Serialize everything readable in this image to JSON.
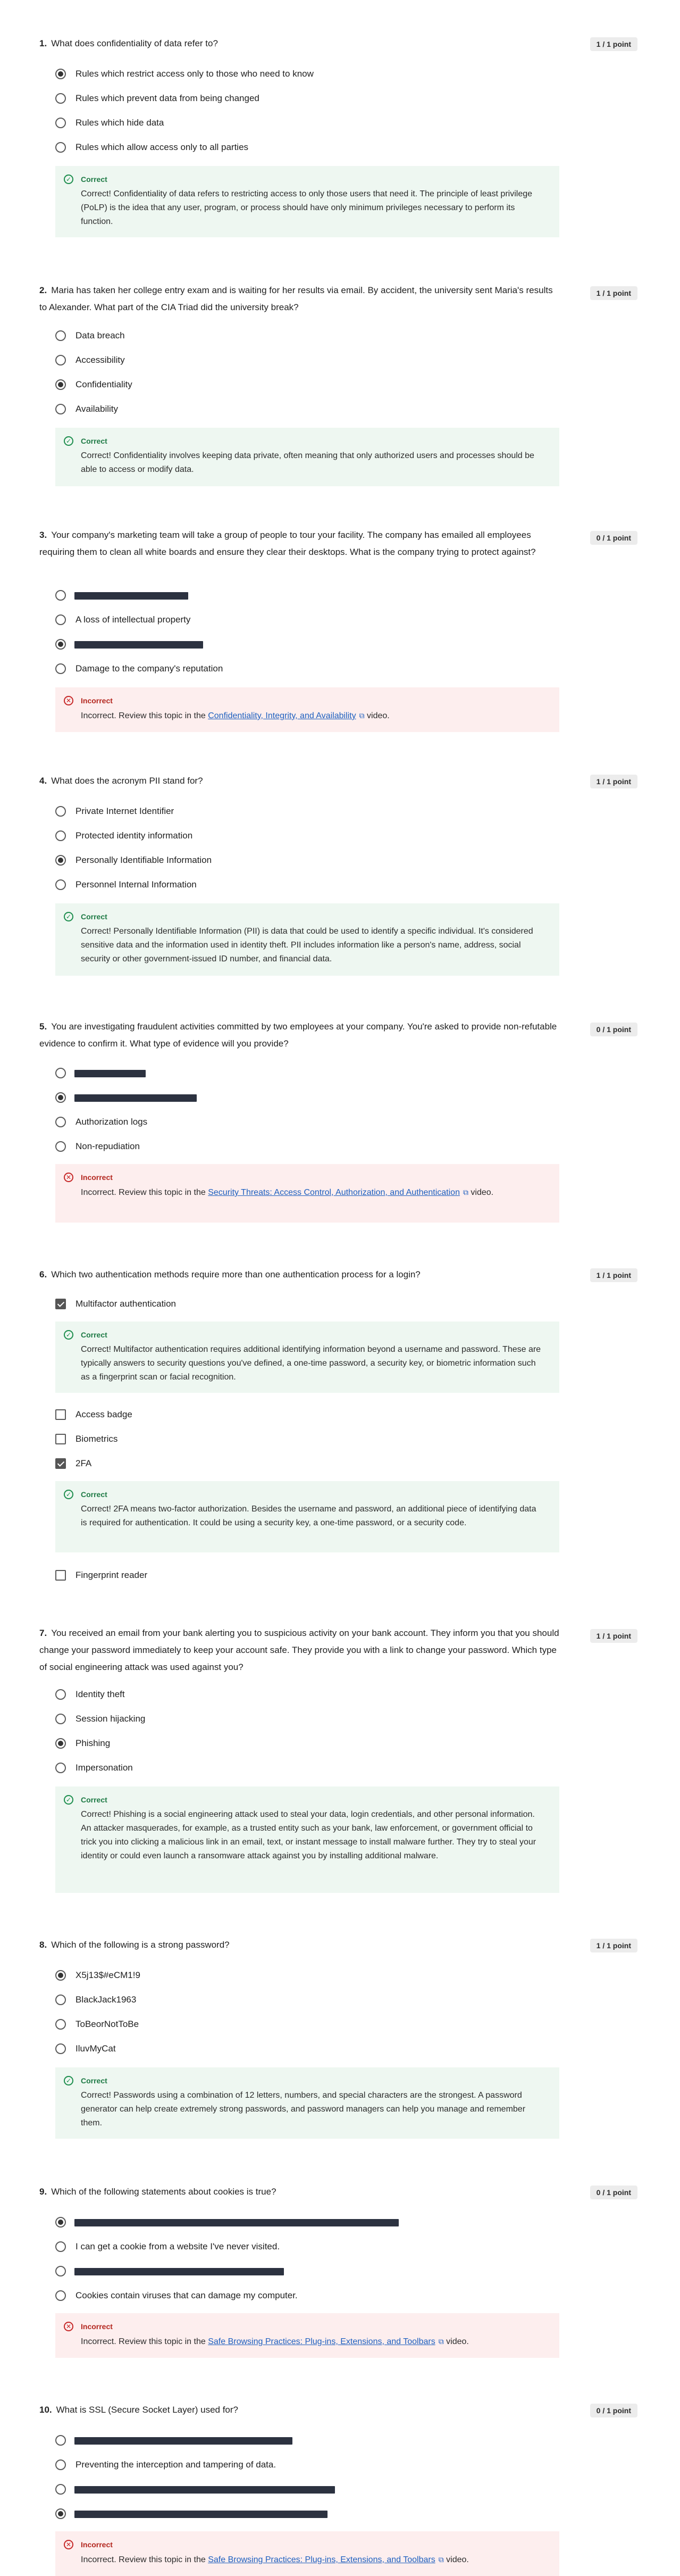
{
  "questions": [
    {
      "num": "1.",
      "text": "What does confidentiality of data refer to?",
      "points": "1 / 1 point",
      "options": [
        {
          "label": "Rules which restrict access only to those who need to know",
          "selected": true
        },
        {
          "label": "Rules which prevent data from being changed"
        },
        {
          "label": "Rules which hide data"
        },
        {
          "label": "Rules which allow access only to all parties"
        }
      ],
      "feedback": {
        "status": "Correct",
        "text": "Correct! Confidentiality of data refers to restricting access to only those users that need it. The principle of least privilege (PoLP) is the idea that any user, program, or process should have only minimum privileges necessary to perform its function."
      }
    },
    {
      "num": "2.",
      "text": "Maria has taken her college entry exam and is waiting for her results via email. By accident, the university sent Maria's results to Alexander. What part of the CIA Triad did the university break?",
      "points": "1 / 1 point",
      "options": [
        {
          "label": "Data breach"
        },
        {
          "label": "Accessibility"
        },
        {
          "label": "Confidentiality",
          "selected": true
        },
        {
          "label": "Availability"
        }
      ],
      "feedback": {
        "status": "Correct",
        "text": "Correct! Confidentiality involves keeping data private, often meaning that only authorized users and processes should be able to access or modify data."
      }
    },
    {
      "num": "3.",
      "text": "Your company's marketing team will take a group of people to tour your facility. The company has emailed all employees requiring them to clean all white boards and ensure they clear their desktops. What is the company trying to protect against?",
      "points": "0 / 1 point",
      "options": [
        {
          "label": "",
          "redacted": true
        },
        {
          "label": "A loss of intellectual property"
        },
        {
          "label": "",
          "redacted": true,
          "selected": true
        },
        {
          "label": "Damage to the company's reputation"
        }
      ],
      "feedback": {
        "status": "Incorrect",
        "before": "Incorrect. Review this topic in the ",
        "link": "Confidentiality, Integrity, and Availability",
        "after": " video."
      }
    },
    {
      "num": "4.",
      "text": "What does the acronym PII stand for?",
      "points": "1 / 1 point",
      "options": [
        {
          "label": "Private Internet Identifier"
        },
        {
          "label": "Protected identity information"
        },
        {
          "label": "Personally Identifiable Information",
          "selected": true
        },
        {
          "label": "Personnel Internal Information"
        }
      ],
      "feedback": {
        "status": "Correct",
        "text": "Correct! Personally Identifiable Information (PII) is data that could be used to identify a specific individual. It's considered sensitive data and the information used in identity theft. PII includes information like a person's name, address, social security or other government-issued ID number, and financial data."
      }
    },
    {
      "num": "5.",
      "text": "You are investigating fraudulent activities committed by two employees at your company. You're asked to provide non-refutable evidence to confirm it. What type of evidence will you provide?",
      "points": "0 / 1 point",
      "options": [
        {
          "label": "",
          "redacted": true
        },
        {
          "label": "",
          "redacted": true,
          "selected": true
        },
        {
          "label": "Authorization logs"
        },
        {
          "label": "Non-repudiation"
        }
      ],
      "feedback": {
        "status": "Incorrect",
        "before": "Incorrect. Review this topic in the ",
        "link": "Security Threats: Access Control, Authorization, and Authentication",
        "after": " video."
      }
    },
    {
      "num": "6.",
      "text": "Which two authentication methods require more than one authentication process for a login?",
      "points": "1 / 1 point",
      "checkbox": true,
      "options": [
        {
          "label": "Multifactor authentication",
          "selected": true,
          "feedback": {
            "status": "Correct",
            "text": "Correct! Multifactor authentication requires additional identifying information beyond a username and password. These are typically answers to security questions you've defined, a one-time password, a security key, or biometric information such as a fingerprint scan or facial recognition."
          }
        },
        {
          "label": "Access badge"
        },
        {
          "label": "Biometrics"
        },
        {
          "label": "2FA",
          "selected": true,
          "feedback": {
            "status": "Correct",
            "text": "Correct! 2FA means two-factor authorization. Besides the username and password, an additional piece of identifying data is required for authentication. It could be using a security key, a one-time password, or a security code."
          }
        },
        {
          "label": "Fingerprint reader"
        }
      ]
    },
    {
      "num": "7.",
      "text": "You received an email from your bank alerting you to suspicious activity on your bank account. They inform you that you should change your password immediately to keep your account safe. They provide you with a link to change your password. Which type of social engineering attack was used against you?",
      "points": "1 / 1 point",
      "options": [
        {
          "label": "Identity theft"
        },
        {
          "label": "Session hijacking"
        },
        {
          "label": "Phishing",
          "selected": true
        },
        {
          "label": "Impersonation"
        }
      ],
      "feedback": {
        "status": "Correct",
        "text": "Correct! Phishing is a social engineering attack used to steal your data, login credentials, and other personal information. An attacker masquerades, for example, as a trusted entity such as your bank, law enforcement, or government official to trick you into clicking a malicious link in an email, text, or instant message to install malware further. They try to steal your identity or could even launch a ransomware attack against you by installing additional malware."
      }
    },
    {
      "num": "8.",
      "text": "Which of the following is a strong password?",
      "points": "1 / 1 point",
      "options": [
        {
          "label": "X5j13$#eCM1!9",
          "selected": true
        },
        {
          "label": "BlackJack1963"
        },
        {
          "label": "ToBeorNotToBe"
        },
        {
          "label": "IluvMyCat"
        }
      ],
      "feedback": {
        "status": "Correct",
        "text": "Correct! Passwords using a combination of 12 letters, numbers, and special characters are the strongest. A password generator can help create extremely strong passwords, and password managers can help you manage and remember them."
      }
    },
    {
      "num": "9.",
      "text": "Which of the following statements about cookies is true?",
      "points": "0 / 1 point",
      "options": [
        {
          "label": "",
          "redacted": true,
          "selected": true
        },
        {
          "label": "I can get a cookie from a website I've never visited."
        },
        {
          "label": "",
          "redacted": true
        },
        {
          "label": "Cookies contain viruses that can damage my computer."
        }
      ],
      "feedback": {
        "status": "Incorrect",
        "before": "Incorrect. Review this topic in the ",
        "link": "Safe Browsing Practices: Plug-ins, Extensions, and Toolbars",
        "after": " video."
      }
    },
    {
      "num": "10.",
      "text": "What is SSL (Secure Socket Layer) used for?",
      "points": "0 / 1 point",
      "options": [
        {
          "label": "",
          "redacted": true
        },
        {
          "label": "Preventing the interception and tampering of data."
        },
        {
          "label": "",
          "redacted": true
        },
        {
          "label": "",
          "redacted": true,
          "selected": true
        }
      ],
      "feedback": {
        "status": "Incorrect",
        "before": "Incorrect. Review this topic in the ",
        "link": "Safe Browsing Practices: Plug-ins, Extensions, and Toolbars",
        "after": " video."
      }
    }
  ],
  "colors": {
    "correct_bg": "#eef7f1",
    "correct_accent": "#1e7a45",
    "incorrect_bg": "#fdeeee",
    "incorrect_accent": "#b3261e",
    "link": "#1d5fbf",
    "redaction": "#2c3240"
  }
}
